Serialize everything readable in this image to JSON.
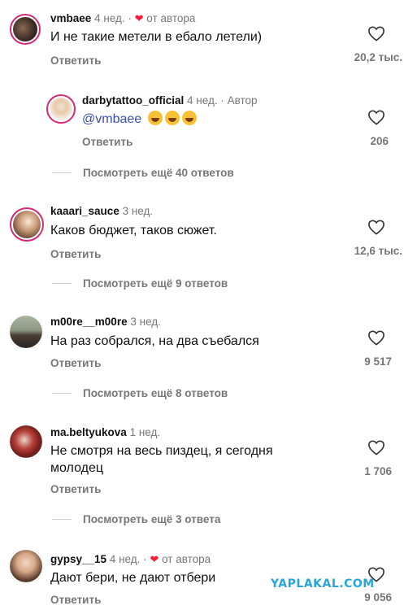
{
  "colors": {
    "heart": "#ff1a3c",
    "mention": "#3a4fb0",
    "muted": "#777777",
    "watermark": "#2aa6d6"
  },
  "comments": [
    {
      "username": "vmbaee",
      "age": "4 нед.",
      "tag": "от автора",
      "text": "И не такие метели в ебало летели)",
      "reply_label": "Ответить",
      "likes": "20,2 тыс."
    },
    {
      "username": "darbytattoo_official",
      "age": "4 нед.",
      "tag": "Автор",
      "mention": "@vmbaee",
      "emoji": [
        "face-with-tears-of-joy",
        "face-with-tears-of-joy",
        "face-with-tears-of-joy"
      ],
      "reply_label": "Ответить",
      "likes": "206",
      "more_replies": "Посмотреть ещё 40 ответов"
    },
    {
      "username": "kaaari_sauce",
      "age": "3 нед.",
      "text": "Каков бюджет, таков сюжет.",
      "reply_label": "Ответить",
      "likes": "12,6 тыс.",
      "more_replies": "Посмотреть ещё 9 ответов"
    },
    {
      "username": "m00re__m00re",
      "age": "3 нед.",
      "text": "На раз собрался, на два съебался",
      "reply_label": "Ответить",
      "likes": "9 517",
      "more_replies": "Посмотреть ещё 8 ответов"
    },
    {
      "username": "ma.beltyukova",
      "age": "1 нед.",
      "text_line1": "Не смотря на весь пиздец, я сегодня",
      "text_line2": "молодец",
      "reply_label": "Ответить",
      "likes": "1 706",
      "more_replies": "Посмотреть ещё 3 ответа"
    },
    {
      "username": "gypsy__15",
      "age": "4 нед.",
      "tag": "от автора",
      "text": "Дают бери,  не дают отбери",
      "reply_label": "Ответить",
      "likes": "9 056"
    }
  ],
  "watermark": "YAPLAKAL.COM"
}
